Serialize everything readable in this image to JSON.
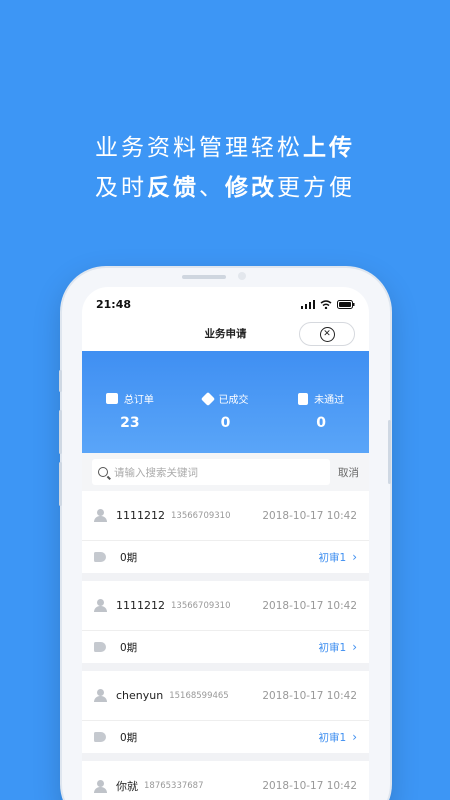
{
  "hero": {
    "line1_plain": "业务资料管理轻松",
    "line1_bold": "上传",
    "line2_part1": "及时",
    "line2_bold1": "反馈",
    "line2_sep": "、",
    "line2_bold2": "修改",
    "line2_part2": "更方便"
  },
  "status_bar": {
    "time": "21:48"
  },
  "navbar": {
    "title": "业务申请"
  },
  "stats": [
    {
      "label": "总订单",
      "value": "23"
    },
    {
      "label": "已成交",
      "value": "0"
    },
    {
      "label": "未通过",
      "value": "0"
    }
  ],
  "search": {
    "placeholder": "请输入搜索关键词",
    "cancel": "取消"
  },
  "cards": [
    {
      "name": "1111212",
      "phone": "13566709310",
      "date": "2018-10-17 10:42",
      "period": "0期",
      "status": "初审1"
    },
    {
      "name": "1111212",
      "phone": "13566709310",
      "date": "2018-10-17 10:42",
      "period": "0期",
      "status": "初审1"
    },
    {
      "name": "chenyun",
      "phone": "15168599465",
      "date": "2018-10-17 10:42",
      "period": "0期",
      "status": "初审1"
    },
    {
      "name": "你就",
      "phone": "18765337687",
      "date": "2018-10-17 10:42",
      "period": "",
      "status": ""
    }
  ],
  "colors": {
    "brand": "#3d96f5",
    "link": "#3d8ef0"
  }
}
